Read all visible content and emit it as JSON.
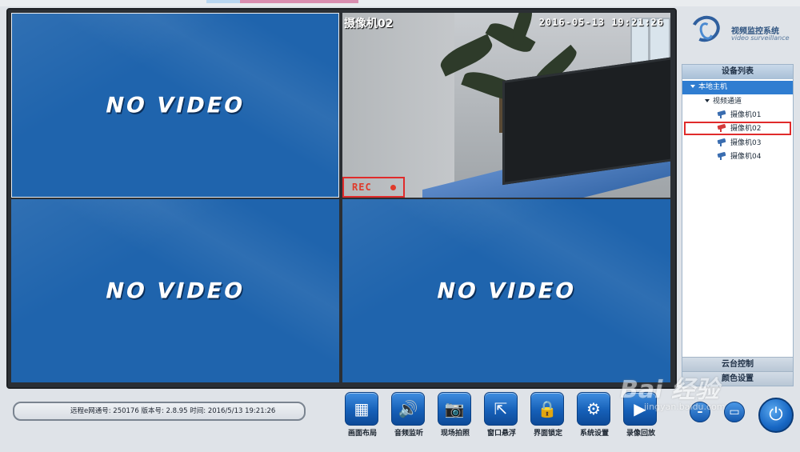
{
  "video": {
    "no_video_text": "NO VIDEO",
    "camera_title": "摄像机02",
    "camera_timestamp": "2016-05-13  19:21:26",
    "rec_label": "REC"
  },
  "logo": {
    "name_cn": "视频监控系统",
    "name_en": "video surveillance"
  },
  "sidebar": {
    "header": "设备列表",
    "host": "本地主机",
    "group": "视频通道",
    "cameras": [
      "摄像机01",
      "摄像机02",
      "摄像机03",
      "摄像机04"
    ],
    "selected_camera": "摄像机02",
    "footer_ptz": "云台控制",
    "footer_color": "颜色设置"
  },
  "status_bar": {
    "text": "远程e网通号: 250176  版本号:  2.8.95  时间:  2016/5/13 19:21:26"
  },
  "toolbar": {
    "buttons": [
      "画面布局",
      "音频监听",
      "现场拍照",
      "窗口悬浮",
      "界面锁定",
      "系统设置",
      "录像回放"
    ]
  },
  "window_controls": {
    "minimize": "–",
    "restore": "▭",
    "power": "⏻"
  },
  "watermark": {
    "main": "Bai 经验",
    "sub": "jingyan.baidu.com"
  }
}
